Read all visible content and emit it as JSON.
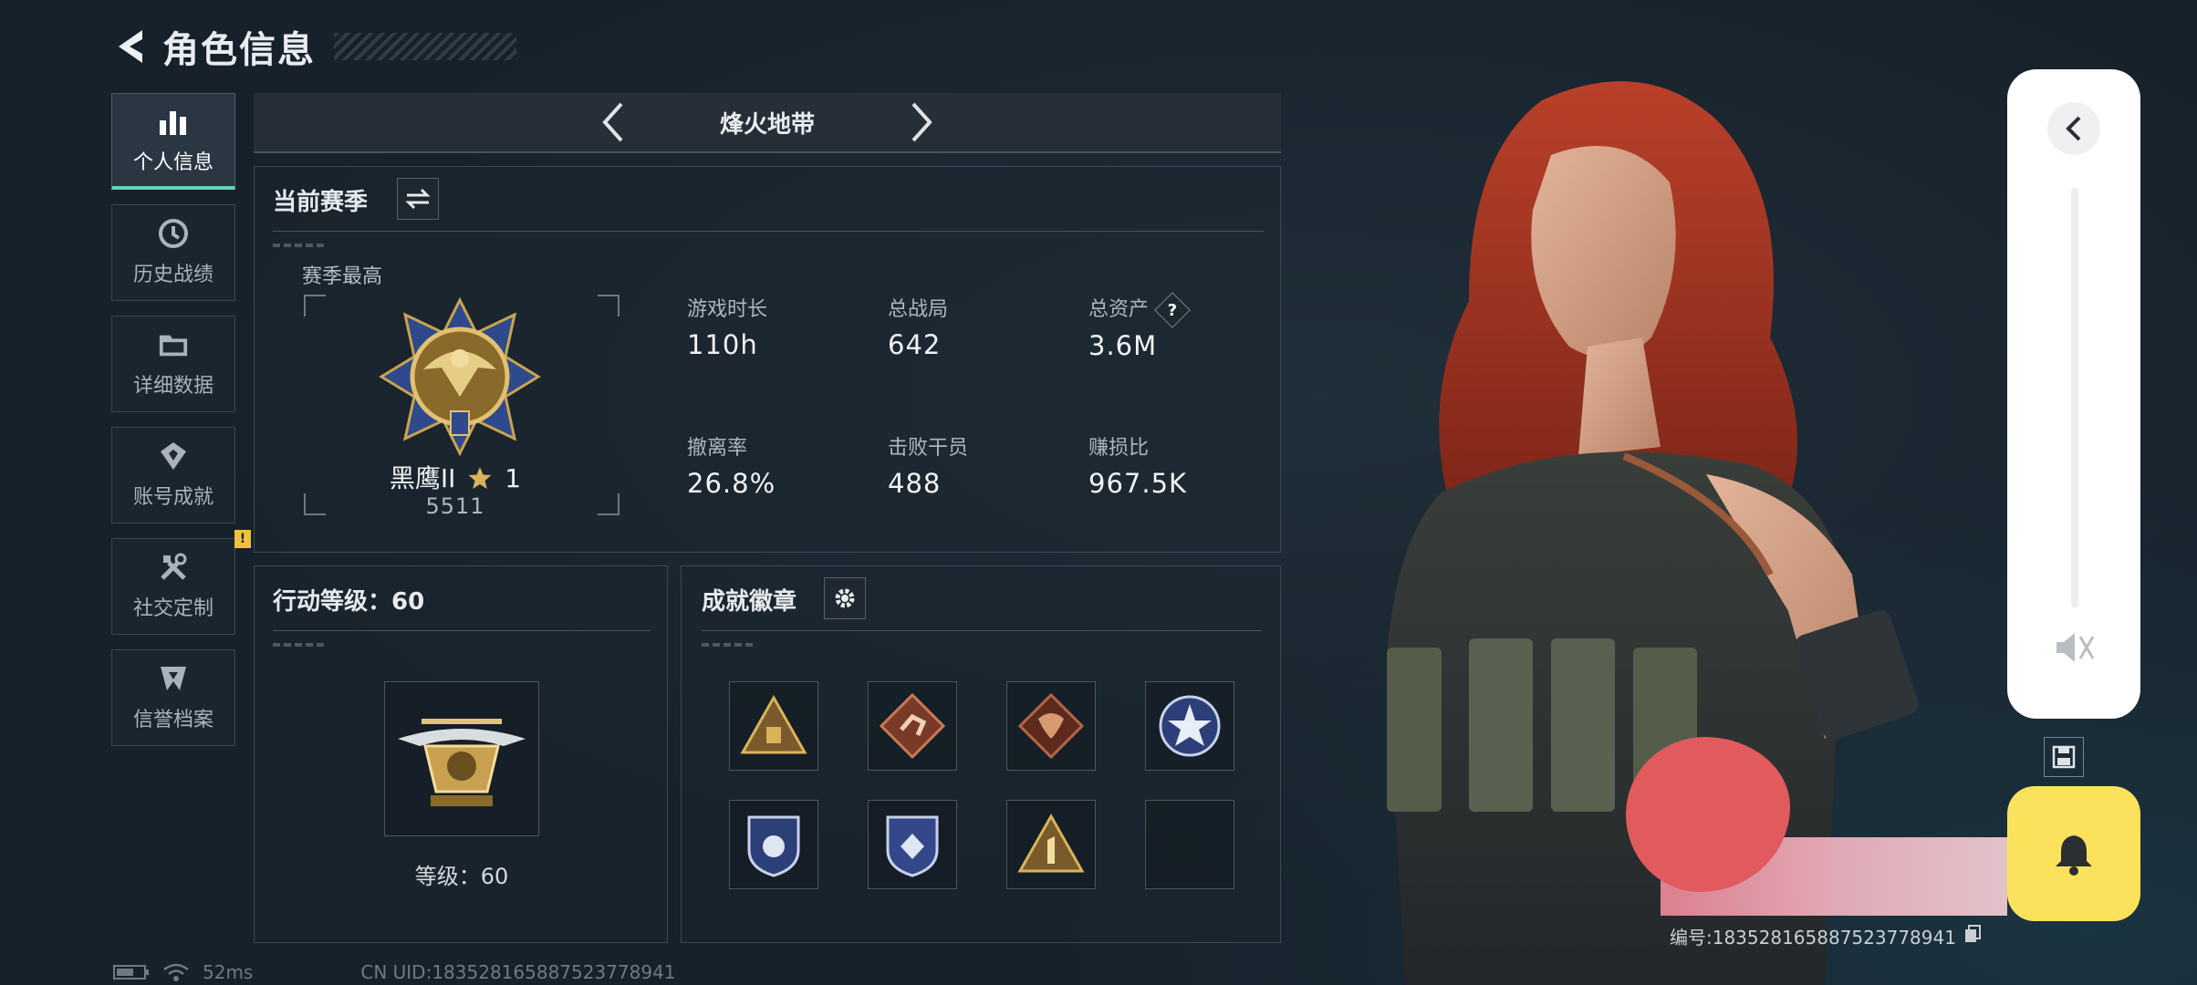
{
  "header": {
    "title": "角色信息"
  },
  "sidebar": {
    "items": [
      {
        "label": "个人信息",
        "icon": "bar-chart-icon",
        "active": true
      },
      {
        "label": "历史战绩",
        "icon": "history-icon"
      },
      {
        "label": "详细数据",
        "icon": "folder-icon"
      },
      {
        "label": "账号成就",
        "icon": "achievement-icon"
      },
      {
        "label": "社交定制",
        "icon": "tools-icon",
        "badge": "!"
      },
      {
        "label": "信誉档案",
        "icon": "shield-mark-icon"
      }
    ]
  },
  "mode": {
    "title": "烽火地带"
  },
  "season": {
    "title": "当前赛季",
    "best_label": "赛季最高",
    "rank_name": "黑鹰II",
    "rank_stars": "1",
    "rank_score": "5511",
    "stats": [
      {
        "label": "游戏时长",
        "value": "110h"
      },
      {
        "label": "总战局",
        "value": "642"
      },
      {
        "label": "总资产",
        "value": "3.6M",
        "help": "?"
      },
      {
        "label": "撤离率",
        "value": "26.8%"
      },
      {
        "label": "击败干员",
        "value": "488"
      },
      {
        "label": "赚损比",
        "value": "967.5K"
      }
    ]
  },
  "level": {
    "title": "行动等级：60",
    "caption": "等级：60"
  },
  "achievements": {
    "title": "成就徽章",
    "badges": [
      {
        "icon": "triangle-rank-badge-icon",
        "color": "#c9a050"
      },
      {
        "icon": "runner-diamond-badge-icon",
        "color": "#c97a55"
      },
      {
        "icon": "dragon-diamond-badge-icon",
        "color": "#b56545"
      },
      {
        "icon": "star-round-badge-icon",
        "color": "#8aa7d8"
      },
      {
        "icon": "shield-badge-blue-icon",
        "color": "#6f86c6"
      },
      {
        "icon": "shield-badge-diamond-icon",
        "color": "#7c93cc"
      },
      {
        "icon": "triangle-number-one-badge-icon",
        "color": "#c9a050"
      },
      {
        "icon": "empty-slot",
        "color": "#1c242c"
      }
    ]
  },
  "player": {
    "id_text": "编号:18352816588752377894​1"
  },
  "status": {
    "ping": "52ms",
    "uid": "CN UID:18352816588752377894​1"
  },
  "colors": {
    "accent": "#5fd6b5",
    "bell": "#fbe25c",
    "badge": "#f0c040"
  }
}
